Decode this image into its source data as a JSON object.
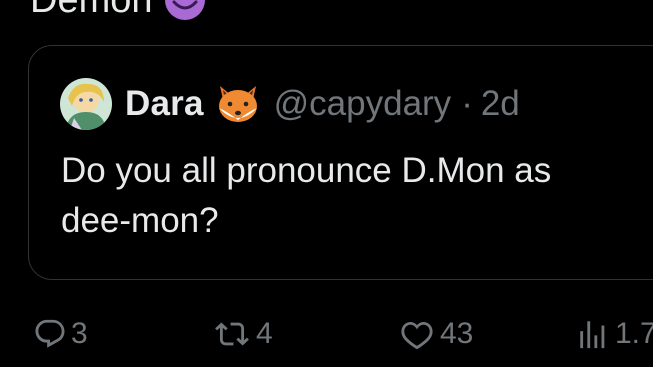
{
  "top_text": "Demon",
  "quoted_post": {
    "author_name": "Dara",
    "handle": "@capydary",
    "separator": "·",
    "time": "2d",
    "text": "Do you all pronounce D.Mon as\ndee-mon?"
  },
  "actions": {
    "reply_count": "3",
    "retweet_count": "4",
    "like_count": "43",
    "views_count": "1.7"
  },
  "colors": {
    "background": "#000000",
    "text": "#e7e9ea",
    "secondary": "#71767b",
    "border": "#2f3336",
    "devil": "#a96ad6"
  },
  "icons": {
    "top": "smiling-devil-emoji",
    "author_badge": "fox-emoji",
    "reply": "reply-icon",
    "retweet": "retweet-icon",
    "like": "heart-icon",
    "views": "views-icon"
  }
}
